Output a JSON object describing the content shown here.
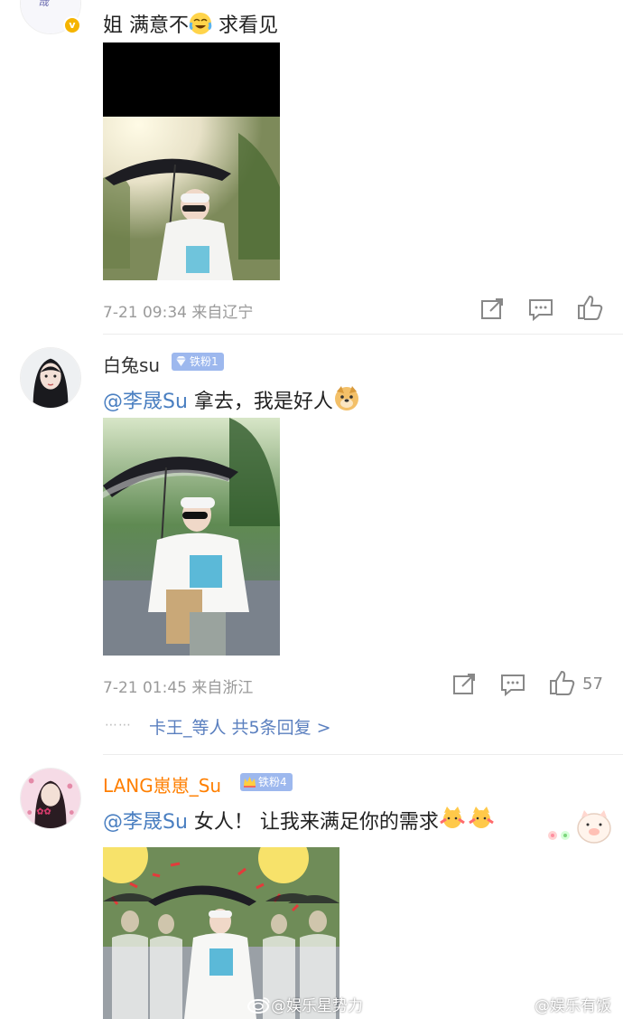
{
  "comment1": {
    "text_prefix": "姐 满意不",
    "text_suffix": " 求看见",
    "emoji": "crying-laughing-emoji",
    "time_location": "7-21 09:34 来自辽宁"
  },
  "comment2": {
    "username": "白兔su",
    "badge": "铁粉1",
    "mention": "@李晟Su",
    "text": " 拿去，我是好人",
    "emoji": "doge-emoji",
    "time_location": "7-21 01:45 来自浙江",
    "like_count": "57",
    "replies_dots": "⋯⋯",
    "replies_text": "卡王_等人  共5条回复 >"
  },
  "comment3": {
    "username": "LANG崽崽_Su",
    "badge": "铁粉4",
    "mention": "@李晟Su",
    "text": " 女人！ 让我来满足你的需求",
    "emoji": "cat-emoji"
  },
  "watermarks": {
    "left": "@娱乐星势力",
    "right": "@娱乐有饭"
  },
  "colors": {
    "mention": "#4a7fc1",
    "orange_username": "#ff7f00",
    "badge": "#9db8ee",
    "meta": "#9a9a9a",
    "verified": "#f5b400"
  }
}
